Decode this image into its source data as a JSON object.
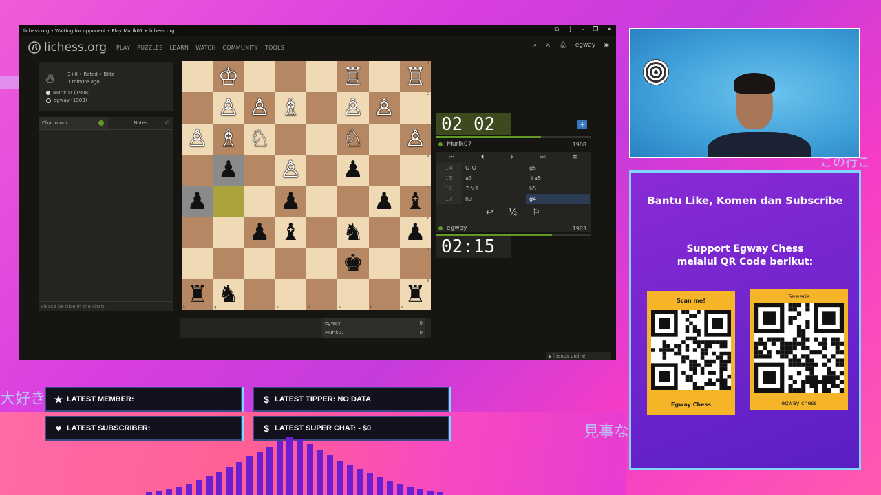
{
  "browser": {
    "title_bar": "lichess.org • Waiting for opponent • Play Murik07 • lichess.org",
    "logo": "lichess.org",
    "menu": [
      "PLAY",
      "PUZZLES",
      "LEARN",
      "WATCH",
      "COMMUNITY",
      "TOOLS"
    ],
    "user": "egway"
  },
  "game_info": {
    "mode": "3+0 • Rated • Blitz",
    "time_ago": "1 minute ago",
    "white_player": "Murik07 (1908)",
    "black_player": "egway (1903)"
  },
  "chat": {
    "tab_chat": "Chat room",
    "tab_notes": "Notes",
    "placeholder": "Please be nice in the chat!"
  },
  "material": {
    "rows": [
      {
        "name": "egway",
        "score": "0"
      },
      {
        "name": "Murik07",
        "score": "0"
      }
    ]
  },
  "clocks": {
    "top": "02 02",
    "top_player": "Murik07",
    "top_rating": "1908",
    "bottom": "02:15",
    "bottom_player": "egway",
    "bottom_rating": "1903"
  },
  "moves": [
    {
      "num": "14",
      "w": "O-O",
      "b": "g5"
    },
    {
      "num": "15",
      "w": "a3",
      "b": "♗a5"
    },
    {
      "num": "16",
      "w": "♖fc1",
      "b": "h5"
    },
    {
      "num": "17",
      "w": "h3",
      "b": "g4"
    }
  ],
  "move_actions": [
    "↩",
    "½",
    "⚐"
  ],
  "friends": "friends online",
  "panel": {
    "title": "Bantu Like, Komen dan Subscribe",
    "support_line1": "Support Egway Chess",
    "support_line2": "melalui QR Code berikut:",
    "qr1_caption": "Scan me!",
    "qr1_footer": "Egway Chess",
    "qr2_caption": "Saweria",
    "qr2_footer": "egway chess"
  },
  "stream_labels": {
    "member": "LATEST MEMBER:",
    "tipper": "LATEST TIPPER: NO DATA",
    "subscriber": "LATEST SUBSCRIBER:",
    "superchat": "LATEST SUPER CHAT:  - $0"
  },
  "bg_text": [
    "大好き",
    "見事な",
    "この行こ"
  ],
  "board": [
    [
      "",
      "♔",
      "",
      "",
      "",
      "♖",
      "",
      "♖"
    ],
    [
      "",
      "♙",
      "♙",
      "♗",
      "",
      "♙",
      "♙",
      ""
    ],
    [
      "♙",
      "♗",
      "♘",
      "",
      "",
      "♘",
      "",
      "♙"
    ],
    [
      "",
      "♟",
      "",
      "♙",
      "",
      "♟",
      "",
      ""
    ],
    [
      "♟",
      "",
      "",
      "♟",
      "",
      "",
      "♟",
      "♝"
    ],
    [
      "",
      "",
      "♟",
      "♝",
      "",
      "♞",
      "",
      "♟"
    ],
    [
      "",
      "",
      "",
      "",
      "",
      "♚",
      "",
      ""
    ],
    [
      "♜",
      "♞",
      "",
      "",
      "",
      "",
      "",
      "♜"
    ]
  ],
  "board_files": [
    "h",
    "g",
    "f",
    "e",
    "d",
    "c",
    "b",
    "a"
  ],
  "board_ranks": [
    "1",
    "2",
    "3",
    "4",
    "5",
    "6",
    "7",
    "8"
  ]
}
